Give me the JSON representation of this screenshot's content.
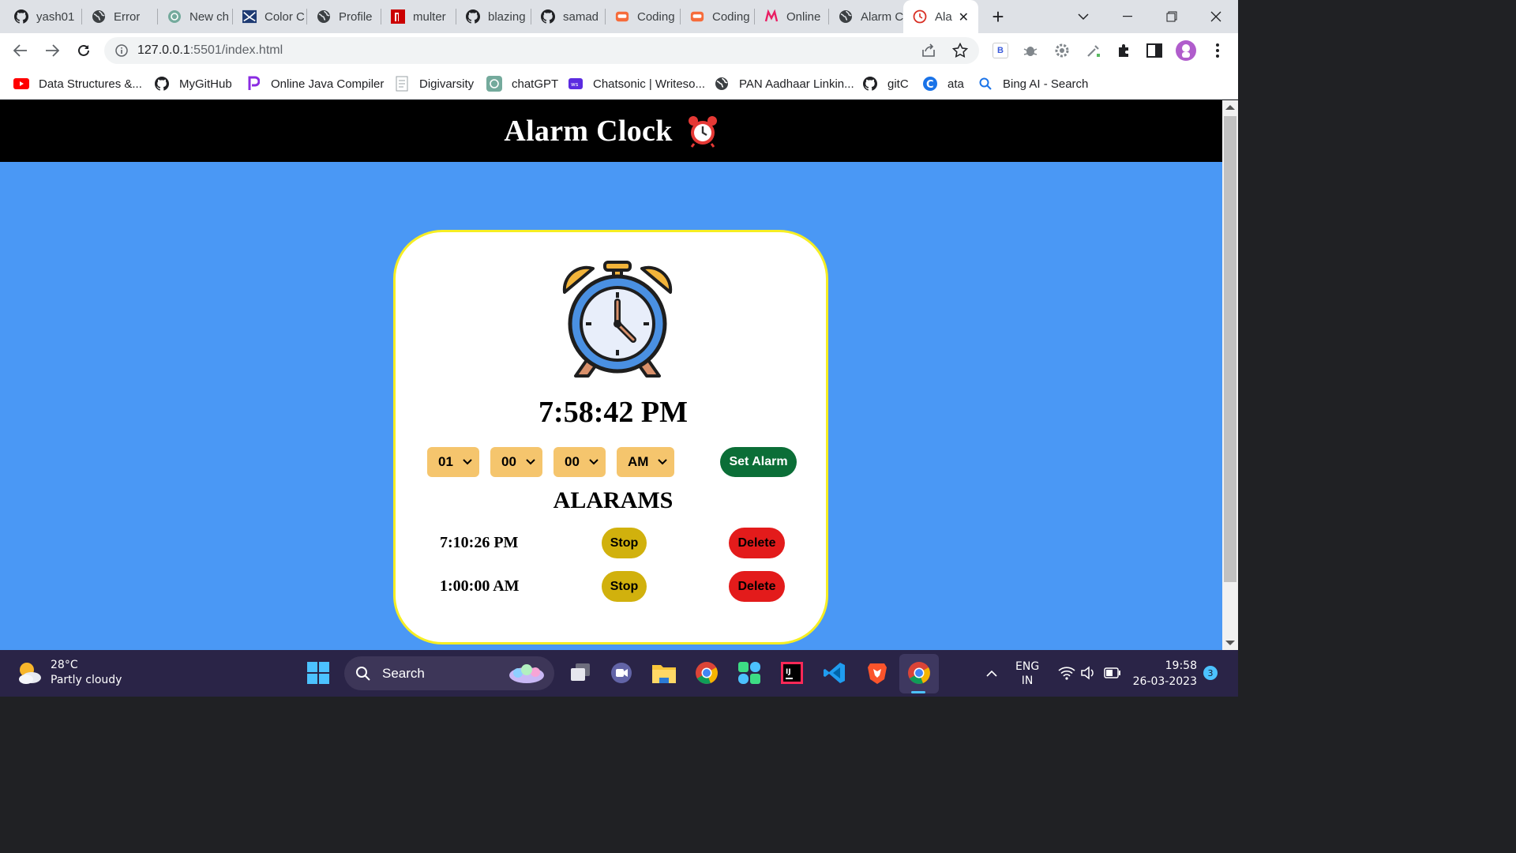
{
  "browser": {
    "tabs": [
      {
        "label": "yash01",
        "icon": "github-icon"
      },
      {
        "label": "Error",
        "icon": "globe-icon"
      },
      {
        "label": "New ch",
        "icon": "chatgpt-icon"
      },
      {
        "label": "Color C",
        "icon": "color-icon"
      },
      {
        "label": "Profile",
        "icon": "globe-icon"
      },
      {
        "label": "multer",
        "icon": "npm-icon"
      },
      {
        "label": "blazing",
        "icon": "github-icon"
      },
      {
        "label": "samad",
        "icon": "github-icon"
      },
      {
        "label": "Coding",
        "icon": "coding-ninjas-icon"
      },
      {
        "label": "Coding",
        "icon": "coding-ninjas-icon"
      },
      {
        "label": "Online",
        "icon": "m-icon"
      },
      {
        "label": "Alarm C",
        "icon": "globe-icon"
      },
      {
        "label": "Ala",
        "icon": "alarm-clock-icon",
        "active": true
      }
    ],
    "url_host": "127.0.0.1",
    "url_rest": ":5501/index.html",
    "extension_badge": "B",
    "bookmarks": [
      {
        "label": "Data Structures &...",
        "icon": "youtube-icon"
      },
      {
        "label": "MyGitHub",
        "icon": "github-icon"
      },
      {
        "label": "Online Java Compiler",
        "icon": "programiz-icon"
      },
      {
        "label": "Digivarsity",
        "icon": "document-icon"
      },
      {
        "label": "chatGPT",
        "icon": "chatgpt-icon"
      },
      {
        "label": "Chatsonic | Writeso...",
        "icon": "writesonic-icon"
      },
      {
        "label": "PAN Aadhaar Linkin...",
        "icon": "globe-icon"
      },
      {
        "label": "gitC",
        "icon": "github-icon"
      },
      {
        "label": "ata",
        "icon": "c-icon"
      },
      {
        "label": "Bing AI - Search",
        "icon": "search-icon"
      }
    ]
  },
  "app": {
    "title": "Alarm Clock",
    "current_time": "7:58:42 PM",
    "selects": {
      "hour": "01",
      "minute": "00",
      "second": "00",
      "ampm": "AM"
    },
    "set_alarm_label": "Set Alarm",
    "alarms_heading": "ALARAMS",
    "alarms": [
      {
        "time": "7:10:26 PM",
        "stop_label": "Stop",
        "delete_label": "Delete"
      },
      {
        "time": "1:00:00 AM",
        "stop_label": "Stop",
        "delete_label": "Delete"
      }
    ],
    "colors": {
      "page_bg": "#4a98f5",
      "header_bg": "#000000",
      "card_border": "#f6ee23",
      "select_bg": "#f5c56d",
      "set_alarm_bg": "#0b6e37",
      "stop_bg": "#d1b10d",
      "delete_bg": "#e31b1b"
    }
  },
  "taskbar": {
    "temperature": "28°C",
    "weather": "Partly cloudy",
    "search_placeholder": "Search",
    "language": "ENG",
    "region": "IN",
    "time": "19:58",
    "date": "26-03-2023",
    "notifications": "3"
  }
}
